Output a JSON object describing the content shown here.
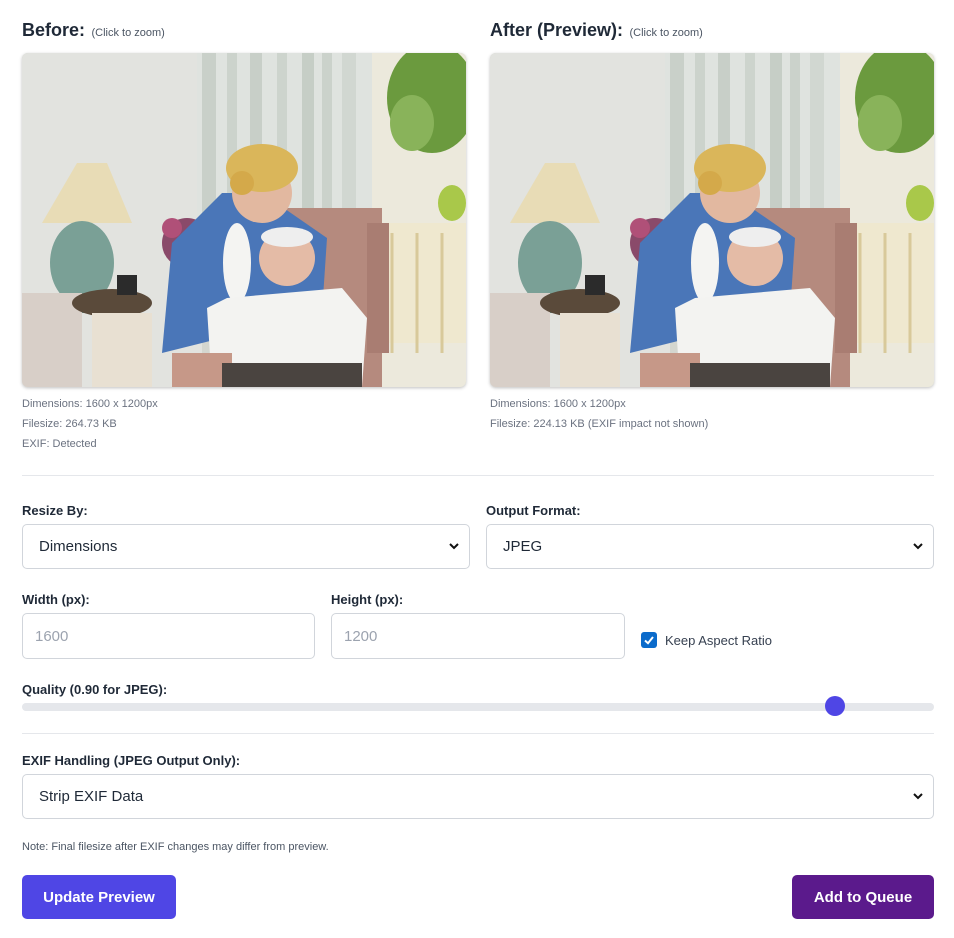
{
  "before": {
    "title": "Before:",
    "hint": "(Click to zoom)",
    "dimensions": "Dimensions: 1600 x 1200px",
    "filesize": "Filesize: 264.73 KB",
    "exif": "EXIF: Detected"
  },
  "after": {
    "title": "After (Preview):",
    "hint": "(Click to zoom)",
    "dimensions": "Dimensions: 1600 x 1200px",
    "filesize": "Filesize: 224.13 KB (EXIF impact not shown)"
  },
  "resize": {
    "label": "Resize By:",
    "value": "Dimensions"
  },
  "format": {
    "label": "Output Format:",
    "value": "JPEG"
  },
  "width": {
    "label": "Width (px):",
    "placeholder": "1600"
  },
  "height": {
    "label": "Height (px):",
    "placeholder": "1200"
  },
  "aspect": {
    "label": "Keep Aspect Ratio",
    "checked": true
  },
  "quality": {
    "label": "Quality (0.90 for JPEG):",
    "value": 0.9
  },
  "exif_handling": {
    "label": "EXIF Handling (JPEG Output Only):",
    "value": "Strip EXIF Data"
  },
  "note": "Note: Final filesize after EXIF changes may differ from preview.",
  "buttons": {
    "update": "Update Preview",
    "queue": "Add to Queue"
  },
  "colors": {
    "primary": "#4f46e5",
    "queue": "#5b1a8c",
    "checkbox": "#0b6bcb"
  }
}
